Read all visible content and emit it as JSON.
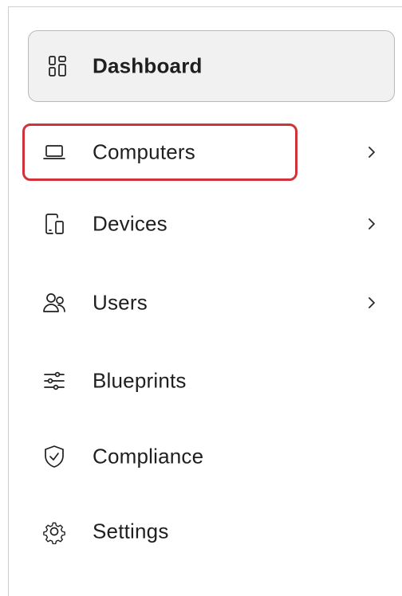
{
  "sidebar": {
    "items": [
      {
        "key": "dashboard",
        "label": "Dashboard",
        "icon": "dashboard-grid-icon",
        "active": true,
        "has_children": false
      },
      {
        "key": "computers",
        "label": "Computers",
        "icon": "laptop-icon",
        "active": false,
        "has_children": true,
        "highlighted": true
      },
      {
        "key": "devices",
        "label": "Devices",
        "icon": "devices-icon",
        "active": false,
        "has_children": true
      },
      {
        "key": "users",
        "label": "Users",
        "icon": "users-icon",
        "active": false,
        "has_children": true
      },
      {
        "key": "blueprints",
        "label": "Blueprints",
        "icon": "sliders-icon",
        "active": false,
        "has_children": false
      },
      {
        "key": "compliance",
        "label": "Compliance",
        "icon": "shield-check-icon",
        "active": false,
        "has_children": false
      },
      {
        "key": "settings",
        "label": "Settings",
        "icon": "gear-icon",
        "active": false,
        "has_children": false
      }
    ]
  },
  "colors": {
    "highlight": "#d0343a",
    "active_background": "#f1f1f1",
    "active_border": "#b9b9b9",
    "text": "#1f1f1f"
  }
}
